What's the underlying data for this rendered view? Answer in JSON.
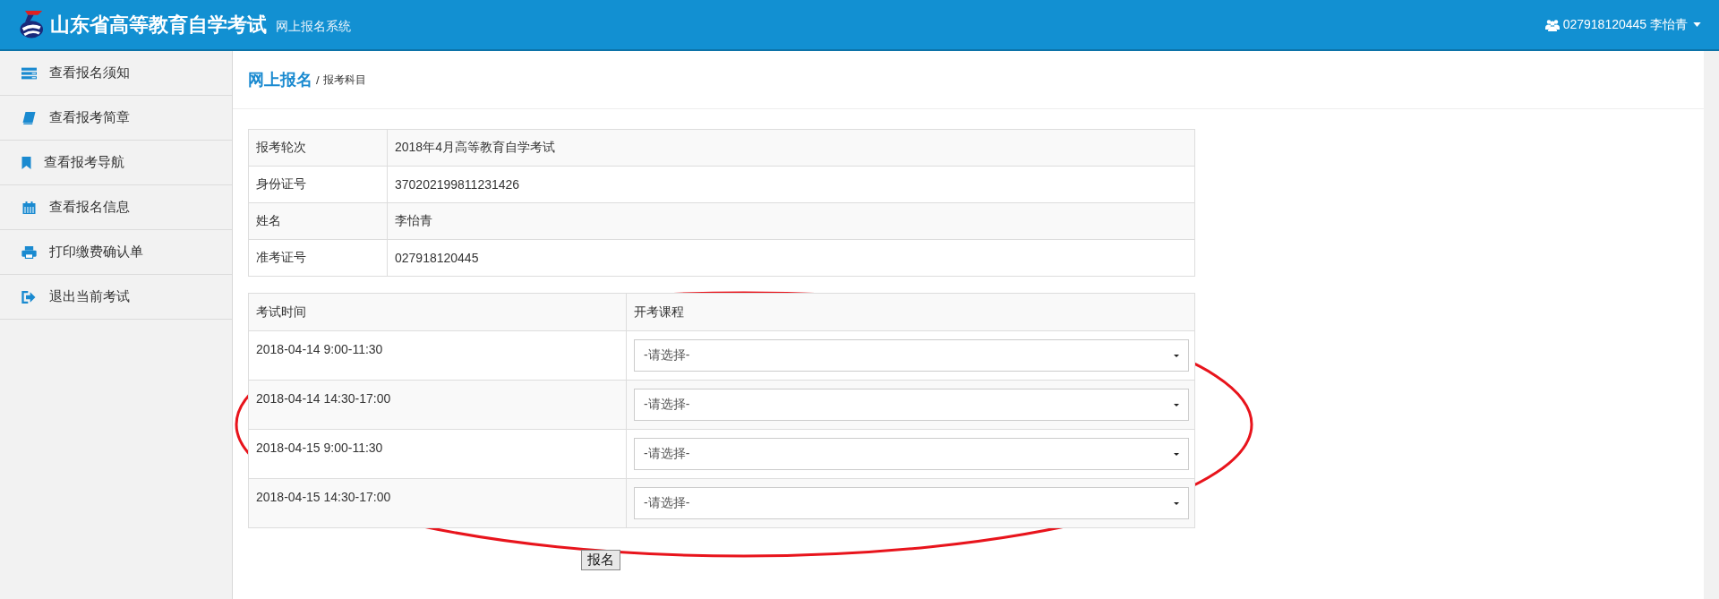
{
  "header": {
    "title": "山东省高等教育自学考试",
    "subtitle": "网上报名系统",
    "user": "027918120445 李怡青"
  },
  "sidebar": {
    "items": [
      {
        "label": "查看报名须知",
        "kind": "list"
      },
      {
        "label": "查看报考简章",
        "kind": "book"
      },
      {
        "label": "查看报考导航",
        "kind": "bookmark"
      },
      {
        "label": "查看报名信息",
        "kind": "calendar"
      },
      {
        "label": "打印缴费确认单",
        "kind": "print"
      },
      {
        "label": "退出当前考试",
        "kind": "exit"
      }
    ]
  },
  "breadcrumb": {
    "title": "网上报名",
    "separator": "/",
    "current": "报考科目"
  },
  "info_table": {
    "rows": [
      {
        "label": "报考轮次",
        "value": "2018年4月高等教育自学考试"
      },
      {
        "label": "身份证号",
        "value": "370202199811231426"
      },
      {
        "label": "姓名",
        "value": "李怡青"
      },
      {
        "label": "准考证号",
        "value": "027918120445"
      }
    ]
  },
  "exam_table": {
    "columns": [
      "考试时间",
      "开考课程"
    ],
    "rows": [
      {
        "time": "2018-04-14 9:00-11:30",
        "course": "-请选择-"
      },
      {
        "time": "2018-04-14 14:30-17:00",
        "course": "-请选择-"
      },
      {
        "time": "2018-04-15 9:00-11:30",
        "course": "-请选择-"
      },
      {
        "time": "2018-04-15 14:30-17:00",
        "course": "-请选择-"
      }
    ]
  },
  "submit_button": "报名"
}
